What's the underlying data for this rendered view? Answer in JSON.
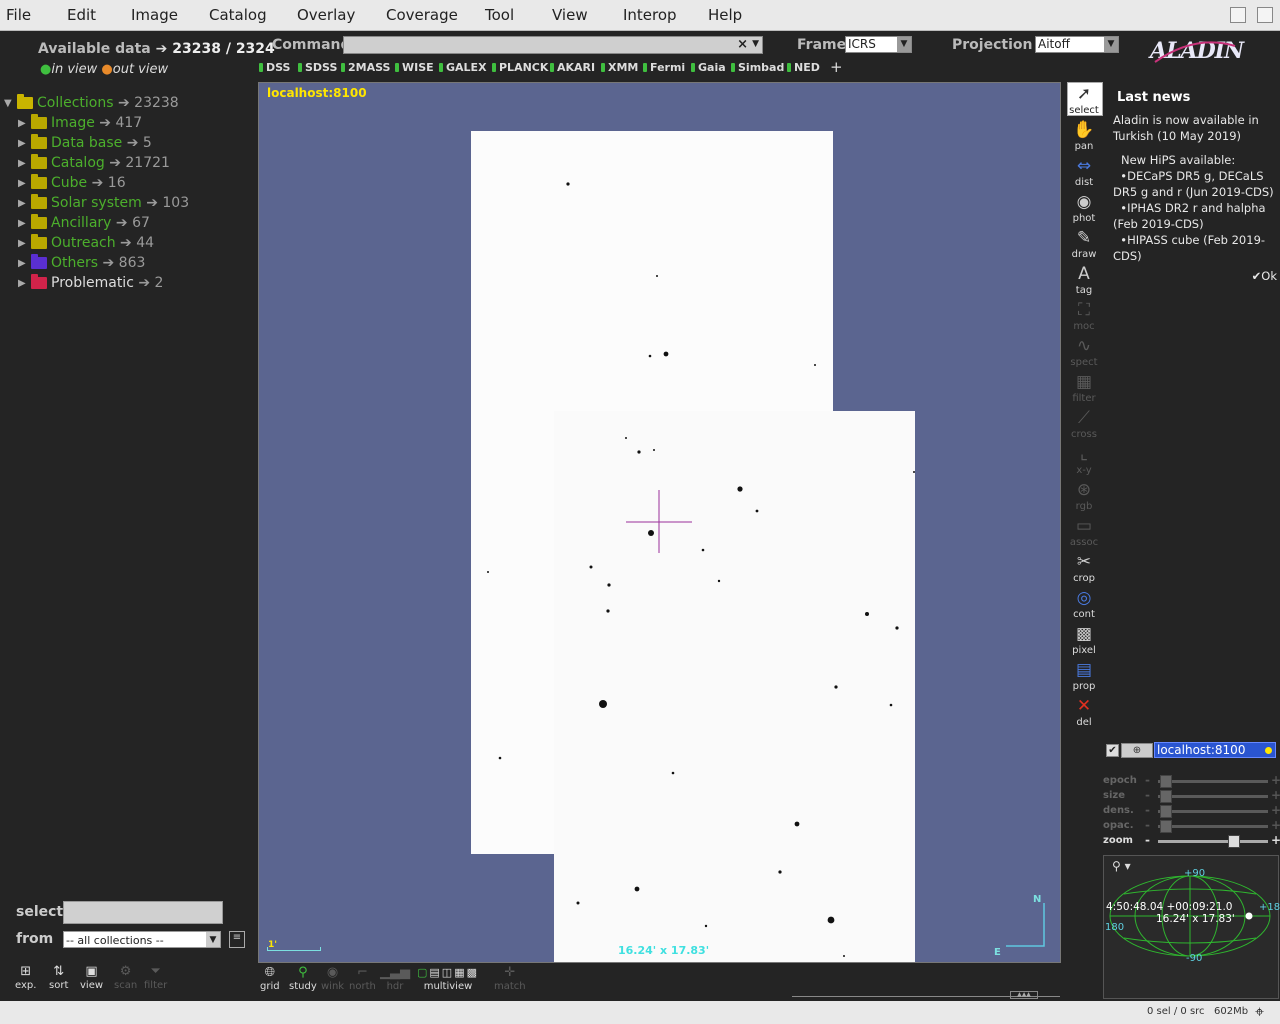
{
  "menubar": {
    "items": [
      "File",
      "Edit",
      "Image",
      "Catalog",
      "Overlay",
      "Coverage",
      "Tool",
      "View",
      "Interop",
      "Help"
    ]
  },
  "left": {
    "available_label": "Available data",
    "available_counts": "23238 / 2324",
    "in_view": "in view",
    "out_view": "out view",
    "tree": [
      {
        "label": "Collections",
        "count": "23238",
        "color": "#c9b400"
      },
      {
        "label": "Image",
        "count": "417",
        "color": "#b9a800"
      },
      {
        "label": "Data base",
        "count": "5",
        "color": "#b9a800"
      },
      {
        "label": "Catalog",
        "count": "21721",
        "color": "#b9a800"
      },
      {
        "label": "Cube",
        "count": "16",
        "color": "#b9a800"
      },
      {
        "label": "Solar system",
        "count": "103",
        "color": "#b9a800"
      },
      {
        "label": "Ancillary",
        "count": "67",
        "color": "#b9a800"
      },
      {
        "label": "Outreach",
        "count": "44",
        "color": "#b9a800"
      },
      {
        "label": "Others",
        "count": "863",
        "color": "#5a2fd0"
      },
      {
        "label": "Problematic",
        "count": "2",
        "color": "#d0234a"
      }
    ],
    "select_label": "select",
    "from_label": "from",
    "from_value": "-- all collections --",
    "bottom_tools": [
      "exp.",
      "sort",
      "view",
      "scan",
      "filter"
    ]
  },
  "command": {
    "label": "Command",
    "value": "",
    "frame_label": "Frame",
    "frame_value": "ICRS",
    "projection_label": "Projection",
    "projection_value": "Aitoff",
    "logo": "ALADIN"
  },
  "surveys": [
    "DSS",
    "SDSS",
    "2MASS",
    "WISE",
    "GALEX",
    "PLANCK",
    "AKARI",
    "XMM",
    "Fermi",
    "Gaia",
    "Simbad",
    "NED"
  ],
  "surveys_add": "+",
  "view": {
    "title": "localhost:8100",
    "fov": "16.24' x 17.83'",
    "scale": "1'",
    "north": "N",
    "east": "E"
  },
  "tools": [
    "select",
    "pan",
    "dist",
    "phot",
    "draw",
    "tag",
    "moc",
    "spect",
    "filter",
    "cross",
    "x-y",
    "rgb",
    "assoc",
    "crop",
    "cont",
    "pixel",
    "prop",
    "del"
  ],
  "news": {
    "title": "Last news",
    "line1": "Aladin is now available in Turkish (10 May 2019)",
    "line2": "New HiPS available:",
    "bullet1": "DECaPS DR5 g, DECaLS DR5 g and r (Jun 2019-CDS)",
    "bullet2": "IPHAS DR2 r and halpha (Feb 2019-CDS)",
    "bullet3": "HIPASS cube (Feb 2019-CDS)",
    "ok": "Ok"
  },
  "layer": {
    "name": "localhost:8100"
  },
  "sliders": [
    {
      "label": "epoch",
      "level": 0.02
    },
    {
      "label": "size",
      "level": 0.02
    },
    {
      "label": "dens.",
      "level": 0.02
    },
    {
      "label": "opac.",
      "level": 0.02
    },
    {
      "label": "zoom",
      "level": 0.7
    }
  ],
  "minimap": {
    "lat_top": "+90",
    "lat_bottom": "-90",
    "lon_right": "+18",
    "lon_left": "180",
    "coords": "4:50:48.04 +00:09:21.0",
    "fov": "16.24' x 17.83'"
  },
  "view_tools": [
    "grid",
    "study",
    "wink",
    "north",
    "hdr",
    "multiview",
    "match"
  ],
  "status": {
    "sel": "0 sel / 0 src",
    "mem": "602Mb"
  }
}
